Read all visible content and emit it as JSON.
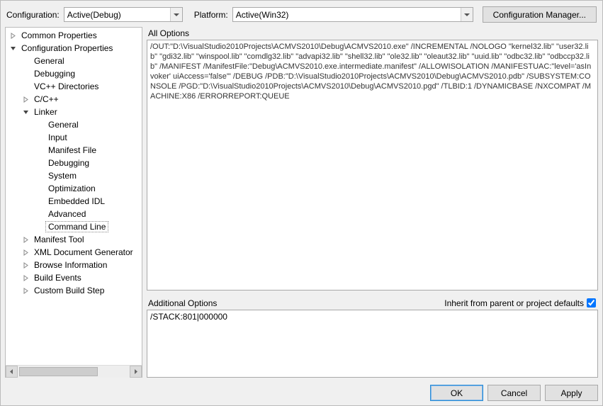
{
  "top": {
    "configuration_label": "Configuration:",
    "configuration_value": "Active(Debug)",
    "platform_label": "Platform:",
    "platform_value": "Active(Win32)",
    "config_manager_button": "Configuration Manager..."
  },
  "tree": {
    "items": [
      {
        "label": "Common Properties",
        "indent": 0,
        "twisty": "closed"
      },
      {
        "label": "Configuration Properties",
        "indent": 0,
        "twisty": "open"
      },
      {
        "label": "General",
        "indent": 1,
        "twisty": "none"
      },
      {
        "label": "Debugging",
        "indent": 1,
        "twisty": "none"
      },
      {
        "label": "VC++ Directories",
        "indent": 1,
        "twisty": "none"
      },
      {
        "label": "C/C++",
        "indent": 1,
        "twisty": "closed",
        "twisty_indent": true
      },
      {
        "label": "Linker",
        "indent": 1,
        "twisty": "open",
        "twisty_indent": true
      },
      {
        "label": "General",
        "indent": 2,
        "twisty": "none"
      },
      {
        "label": "Input",
        "indent": 2,
        "twisty": "none"
      },
      {
        "label": "Manifest File",
        "indent": 2,
        "twisty": "none"
      },
      {
        "label": "Debugging",
        "indent": 2,
        "twisty": "none"
      },
      {
        "label": "System",
        "indent": 2,
        "twisty": "none"
      },
      {
        "label": "Optimization",
        "indent": 2,
        "twisty": "none"
      },
      {
        "label": "Embedded IDL",
        "indent": 2,
        "twisty": "none"
      },
      {
        "label": "Advanced",
        "indent": 2,
        "twisty": "none"
      },
      {
        "label": "Command Line",
        "indent": 2,
        "twisty": "none",
        "selected": true
      },
      {
        "label": "Manifest Tool",
        "indent": 1,
        "twisty": "closed",
        "twisty_indent": true
      },
      {
        "label": "XML Document Generator",
        "indent": 1,
        "twisty": "closed",
        "twisty_indent": true
      },
      {
        "label": "Browse Information",
        "indent": 1,
        "twisty": "closed",
        "twisty_indent": true
      },
      {
        "label": "Build Events",
        "indent": 1,
        "twisty": "closed",
        "twisty_indent": true
      },
      {
        "label": "Custom Build Step",
        "indent": 1,
        "twisty": "closed",
        "twisty_indent": true
      }
    ]
  },
  "right": {
    "all_options_label": "All Options",
    "all_options_text": "/OUT:\"D:\\VisualStudio2010Projects\\ACMVS2010\\Debug\\ACMVS2010.exe\" /INCREMENTAL /NOLOGO \"kernel32.lib\" \"user32.lib\" \"gdi32.lib\" \"winspool.lib\" \"comdlg32.lib\" \"advapi32.lib\" \"shell32.lib\" \"ole32.lib\" \"oleaut32.lib\" \"uuid.lib\" \"odbc32.lib\" \"odbccp32.lib\" /MANIFEST /ManifestFile:\"Debug\\ACMVS2010.exe.intermediate.manifest\" /ALLOWISOLATION /MANIFESTUAC:\"level='asInvoker' uiAccess='false'\" /DEBUG /PDB:\"D:\\VisualStudio2010Projects\\ACMVS2010\\Debug\\ACMVS2010.pdb\" /SUBSYSTEM:CONSOLE /PGD:\"D:\\VisualStudio2010Projects\\ACMVS2010\\Debug\\ACMVS2010.pgd\" /TLBID:1 /DYNAMICBASE /NXCOMPAT /MACHINE:X86 /ERRORREPORT:QUEUE ",
    "additional_options_label": "Additional Options",
    "inherit_label": "Inherit from parent or project defaults",
    "inherit_checked": true,
    "additional_options_text": "/STACK:801|000000"
  },
  "buttons": {
    "ok": "OK",
    "cancel": "Cancel",
    "apply": "Apply"
  }
}
